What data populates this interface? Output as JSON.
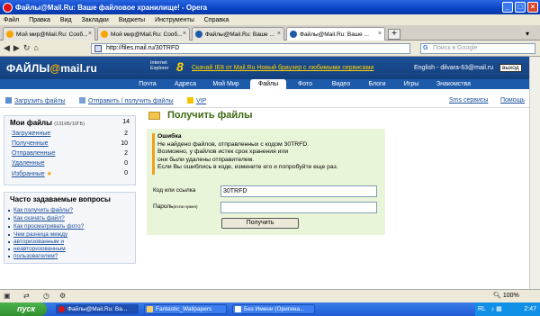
{
  "window": {
    "title": "Файлы@Mail.Ru: Ваше файловое хранилище! - Opera"
  },
  "menu": [
    "Файл",
    "Правка",
    "Вид",
    "Закладки",
    "Виджеты",
    "Инструменты",
    "Справка"
  ],
  "tabs": [
    {
      "label": "Мой мир@Mail.Ru: Сооб..."
    },
    {
      "label": "Мой мир@Mail.Ru: Сооб..."
    },
    {
      "label": "Файлы@Mail.Ru: Ваше ..."
    },
    {
      "label": "Файлы@Mail.Ru: Ваше ..."
    }
  ],
  "address": {
    "url": "http://files.mail.ru/30TRFD",
    "search_placeholder": "Поиск в Google"
  },
  "header": {
    "logo_text": "ФАЙЛЫ",
    "logo_at": "@",
    "logo_domain": "mail.ru",
    "ie_text1": "Internet",
    "ie_text2": "Explorer",
    "ie_num": "8",
    "promo": "Скачай IE8 от Mail.Ru Новый браузер с любимыми сервисами",
    "lang": "English",
    "user": "dilvara-63@mail.ru",
    "logout": "выход"
  },
  "services": [
    "Почта",
    "Адреса",
    "Мой Мир",
    "Файлы",
    "Фото",
    "Видео",
    "Блоги",
    "Игры",
    "Знакомства"
  ],
  "actions": {
    "upload": "Загрузить файлы",
    "send": "Отправить / получить файлы",
    "vip": "VIP",
    "sms": "Sms сервисы",
    "help": "Помощь"
  },
  "myfiles": {
    "title": "Мои файлы",
    "size": "(131КБ/10ГБ)",
    "total": "14",
    "items": [
      {
        "label": "Загруженные",
        "count": "2"
      },
      {
        "label": "Полученные",
        "count": "10"
      },
      {
        "label": "Отправленные",
        "count": "2"
      },
      {
        "label": "Удаленные",
        "count": "0"
      },
      {
        "label": "Избранные",
        "count": "0"
      }
    ]
  },
  "faq": {
    "title": "Часто задаваемые вопросы",
    "items": [
      "Как получить файлы?",
      "Как скачать файл?",
      "Как просматривать фото?",
      "Чем разница между",
      "авторизованным и",
      "неавторизованным",
      "пользователем?"
    ]
  },
  "main": {
    "title": "Получить файлы",
    "error_header": "Ошибка",
    "error_lines": [
      "Не найдено файлов, отправленных с кодом 30TRFD.",
      "Возможно, у файлов истек срок хранения или",
      "они были удалены отправителем.",
      "Если Вы ошиблись в коде, измените его и попробуйте еще раз."
    ],
    "code_label": "Код или ссылка",
    "code_value": "30TRFD",
    "pass_label": "Пароль",
    "pass_hint": "(если нужен)",
    "submit": "Получить"
  },
  "status": {
    "zoom": "100%"
  },
  "taskbar": {
    "start": "пуск",
    "items": [
      "Файлы@Mail.Ru: Ва...",
      "Fantastic_Wallpapers",
      "Без Имени (Оригина..."
    ],
    "lang": "RL",
    "clock": "2:47"
  }
}
